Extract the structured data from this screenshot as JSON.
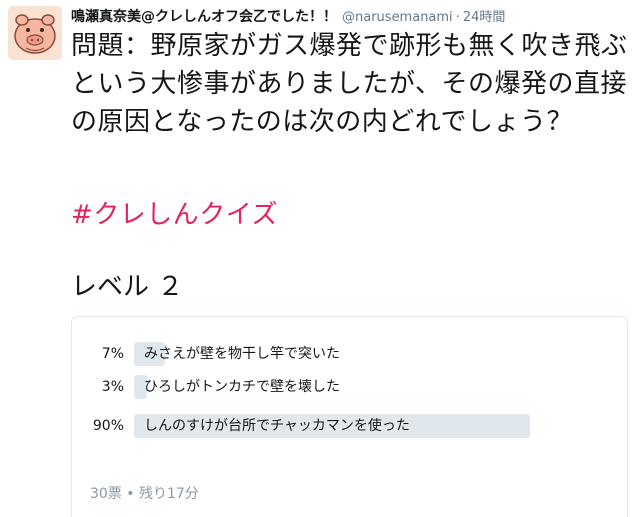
{
  "tweet": {
    "author_name": "鳴瀬真奈美@クレしんオフ会乙でした！！",
    "handle": "@narusemanami",
    "separator": "·",
    "time": "24時間",
    "text": "問題：野原家がガス爆発で跡形も無く吹き飛ぶという大惨事がありましたが、その爆発の直接の原因となったのは次の内どれでしょう？",
    "hashtag": "#クレしんクイズ",
    "level": "レベル ２"
  },
  "poll": {
    "options": [
      {
        "percent_label": "7%",
        "fraction": 0.07,
        "label": "みさえが壁を物干し竿で突いた"
      },
      {
        "percent_label": "3%",
        "fraction": 0.03,
        "label": "ひろしがトンカチで壁を壊した"
      },
      {
        "percent_label": "90%",
        "fraction": 0.9,
        "label": "しんのすけが台所でチャッカマンを使った"
      }
    ],
    "footer": "30票 • 残り17分"
  },
  "colors": {
    "hashtag": "#e0245e",
    "bar": "#e1e8ed",
    "secondary_text": "#657786"
  }
}
